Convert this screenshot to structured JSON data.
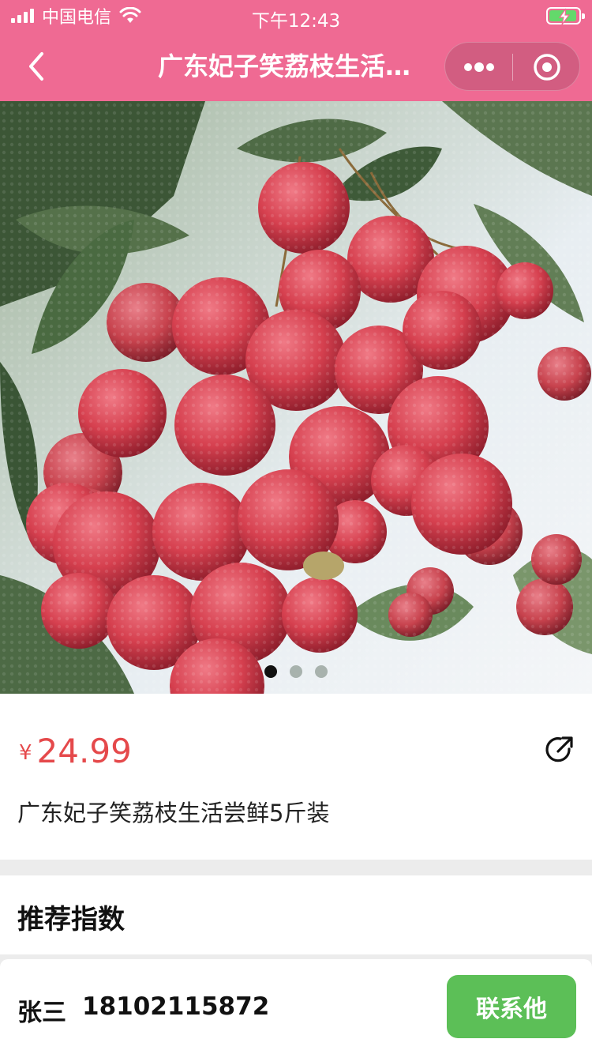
{
  "status_bar": {
    "carrier": "中国电信",
    "time": "下午12:43",
    "battery_level": 0.95,
    "signal_bars": 4
  },
  "nav": {
    "title": "广东妃子笑荔枝生活…",
    "back_icon": "chevron-left-icon",
    "more_icon": "more-dots-icon",
    "close_icon": "mini-program-close-icon"
  },
  "gallery": {
    "slide_count": 3,
    "active_slide": 1
  },
  "product": {
    "currency": "¥",
    "price": "24.99",
    "name": "广东妃子笑荔枝生活尝鲜5斤装",
    "share_icon": "share-icon"
  },
  "recommend": {
    "title": "推荐指数"
  },
  "contact": {
    "name": "张三",
    "phone": "18102115872",
    "button_label": "联系他"
  },
  "colors": {
    "header": "#ef6a93",
    "price": "#e5494b",
    "button": "#5cbf57"
  }
}
